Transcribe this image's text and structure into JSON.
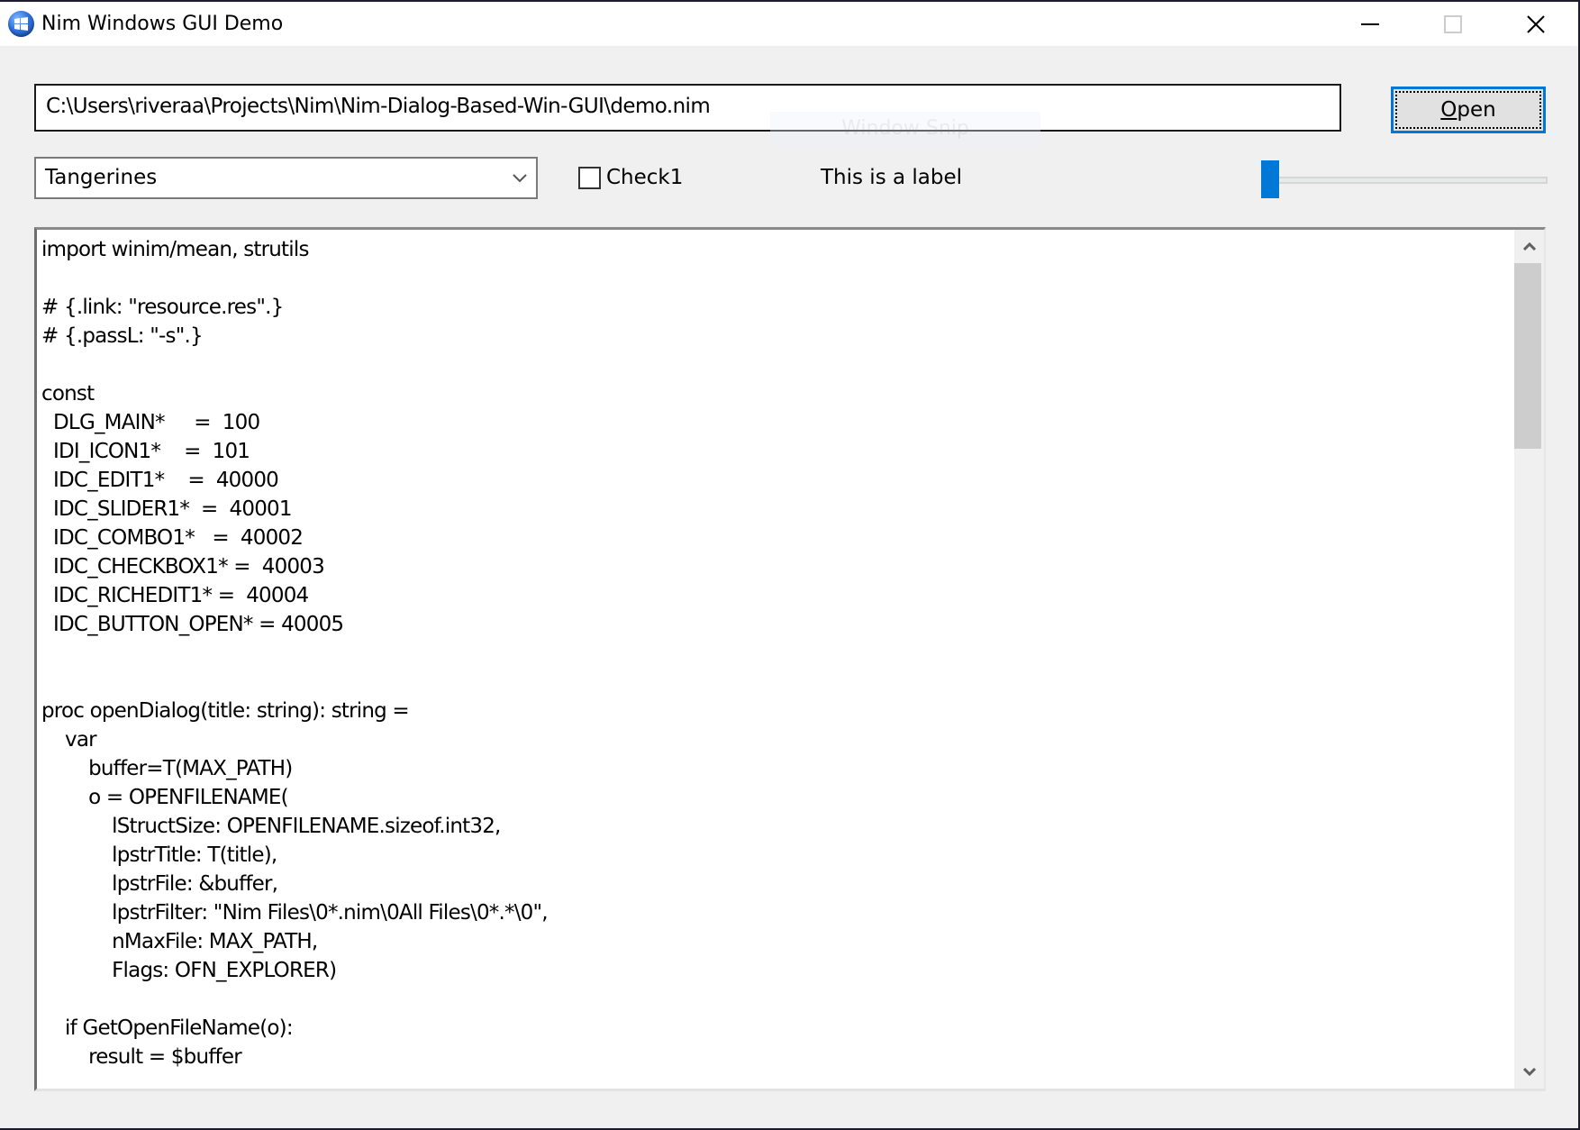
{
  "window": {
    "title": "Nim Windows GUI Demo",
    "app_icon": "nim-app-icon",
    "caption_buttons": {
      "minimize": "minimize-icon",
      "maximize": "maximize-icon",
      "close": "close-icon"
    }
  },
  "overlay": {
    "text": "Window Snip"
  },
  "path_edit": {
    "value": "C:\\Users\\riveraa\\Projects\\Nim\\Nim-Dialog-Based-Win-GUI\\demo.nim"
  },
  "open_button": {
    "label_mnemonic": "O",
    "label_rest": "pen"
  },
  "combo": {
    "selected": "Tangerines",
    "icon": "chevron-down-icon"
  },
  "checkbox": {
    "label": "Check1",
    "checked": false
  },
  "label": {
    "text": "This is a label"
  },
  "slider": {
    "value_fraction": 0.0
  },
  "accent_color": "#0078d7",
  "editor": {
    "lines": [
      "import winim/mean, strutils",
      "",
      "# {.link: \"resource.res\".}",
      "# {.passL: \"-s\".}",
      "",
      "const",
      "  DLG_MAIN*     =  100",
      "  IDI_ICON1*    =  101",
      "  IDC_EDIT1*    =  40000",
      "  IDC_SLIDER1*  =  40001",
      "  IDC_COMBO1*   =  40002",
      "  IDC_CHECKBOX1* =  40003",
      "  IDC_RICHEDIT1* =  40004",
      "  IDC_BUTTON_OPEN* = 40005",
      "",
      "",
      "proc openDialog(title: string): string =",
      "    var",
      "        buffer=T(MAX_PATH)",
      "        o = OPENFILENAME(",
      "            lStructSize: OPENFILENAME.sizeof.int32,",
      "            lpstrTitle: T(title),",
      "            lpstrFile: &buffer,",
      "            lpstrFilter: \"Nim Files\\0*.nim\\0All Files\\0*.*\\0\",",
      "            nMaxFile: MAX_PATH,",
      "            Flags: OFN_EXPLORER)",
      "",
      "    if GetOpenFileName(o):",
      "        result = $buffer"
    ],
    "scrollbar": {
      "up_icon": "scroll-up-icon",
      "down_icon": "scroll-down-icon"
    }
  }
}
